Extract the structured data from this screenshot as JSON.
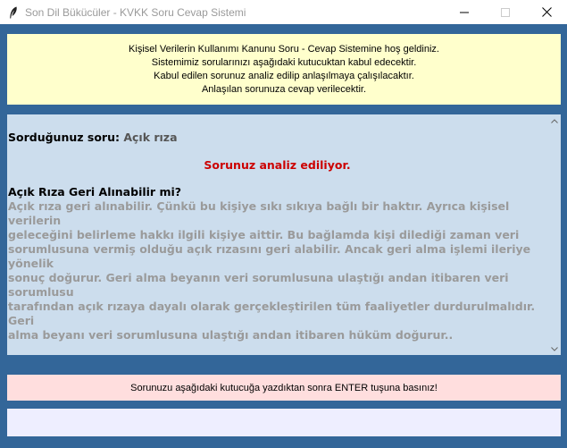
{
  "window": {
    "title": "Son Dil Bükücüler - KVKK Soru Cevap Sistemi",
    "icon": "feather-icon"
  },
  "welcome": {
    "lines": [
      "Kişisel Verilerin Kullanımı Kanunu Soru - Cevap Sistemine hoş geldiniz.",
      "Sistemimiz sorularınızı aşağıdaki kutucuktan kabul edecektir.",
      "Kabul edilen sorunuz analiz edilip anlaşılmaya çalışılacaktır.",
      "Anlaşılan sorunuza cevap verilecektir."
    ]
  },
  "answer": {
    "question_label": "Sorduğunuz soru:",
    "question_text": "Açık rıza",
    "status": "Sorunuz analiz ediliyor.",
    "title": "Açık Rıza Geri Alınabilir mi?",
    "body_lines": [
      "Açık rıza geri alınabilir. Çünkü bu kişiye sıkı sıkıya bağlı bir haktır. Ayrıca kişisel verilerin",
      "geleceğini belirleme hakkı ilgili kişiye aittir. Bu bağlamda kişi dilediği zaman veri",
      "sorumlusuna vermiş olduğu açık rızasını geri alabilir. Ancak geri alma işlemi ileriye yönelik",
      "sonuç doğurur. Geri alma beyanın veri sorumlusuna ulaştığı andan itibaren veri sorumlusu",
      "tarafından açık rızaya dayalı olarak gerçekleştirilen tüm faaliyetler durdurulmalıdır. Geri",
      "alma beyanı veri sorumlusuna ulaştığı andan itibaren hüküm doğurur.."
    ]
  },
  "instruction": "Sorunuzu aşağıdaki kutucuğa yazdıktan sonra ENTER tuşuna basınız!",
  "input": {
    "value": "",
    "placeholder": ""
  },
  "colors": {
    "background": "#336699",
    "welcome_bg": "#ffffcc",
    "answer_bg": "#ccdded",
    "instruction_bg": "#ffdede",
    "input_bg": "#eeeeff",
    "status_text": "#cc0000",
    "answer_text": "#9a9a9a"
  }
}
